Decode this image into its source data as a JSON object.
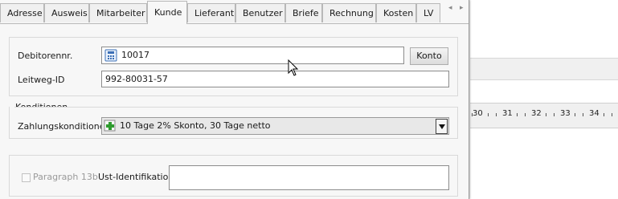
{
  "tabs": [
    "Adresse",
    "Ausweis",
    "Mitarbeiter",
    "Kunde",
    "Lieferant",
    "Benutzer",
    "Briefe",
    "Rechnung",
    "Kosten",
    "LV"
  ],
  "active_tab": "Kunde",
  "customer": {
    "debitor_label": "Debitorennr.",
    "debitor_value": "10017",
    "konto_button": "Konto",
    "leitweg_label": "Leitweg-ID",
    "leitweg_value": "992-80031-57"
  },
  "conditions": {
    "section_title": "Konditionen",
    "payment_label": "Zahlungskonditionen",
    "payment_value": "10 Tage 2% Skonto, 30 Tage netto"
  },
  "tax": {
    "paragraph_label": "Paragraph 13b",
    "paragraph_checked": false,
    "ust_label": "Ust-Identifikation",
    "ust_value": ""
  },
  "ruler": {
    "numbers": [
      "30",
      "31",
      "32",
      "33",
      "34"
    ]
  },
  "icons": {
    "debitor": "calculator-icon",
    "payment": "add-icon",
    "tab_scroll": [
      "scroll-left-icon",
      "scroll-right-icon"
    ]
  },
  "colors": {
    "accent_green": "#2e9b2e",
    "icon_blue": "#3b6fb6"
  }
}
